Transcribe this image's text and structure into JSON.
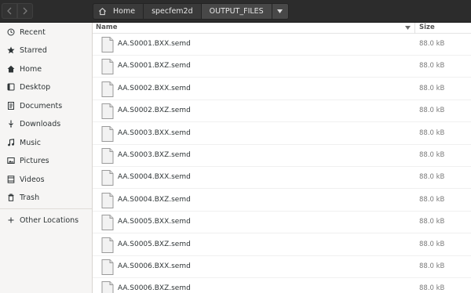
{
  "header": {
    "back_icon": "chevron-left-icon",
    "forward_icon": "chevron-right-icon",
    "breadcrumbs": [
      {
        "label": "Home",
        "icon": "home-icon"
      },
      {
        "label": "specfem2d"
      },
      {
        "label": "OUTPUT_FILES"
      }
    ],
    "dropdown_icon": "triangle-down-icon"
  },
  "sidebar": {
    "items": [
      {
        "label": "Recent",
        "icon": "clock-icon"
      },
      {
        "label": "Starred",
        "icon": "star-icon"
      },
      {
        "label": "Home",
        "icon": "home-icon"
      },
      {
        "label": "Desktop",
        "icon": "desktop-icon"
      },
      {
        "label": "Documents",
        "icon": "document-icon"
      },
      {
        "label": "Downloads",
        "icon": "download-icon"
      },
      {
        "label": "Music",
        "icon": "music-icon"
      },
      {
        "label": "Pictures",
        "icon": "picture-icon"
      },
      {
        "label": "Videos",
        "icon": "video-icon"
      },
      {
        "label": "Trash",
        "icon": "trash-icon"
      }
    ],
    "other_locations": {
      "label": "Other Locations",
      "icon": "plus-icon"
    }
  },
  "list": {
    "columns": {
      "name": "Name",
      "size": "Size"
    },
    "sort_icon": "sort-descending-icon",
    "files": [
      {
        "name": "AA.S0001.BXX.semd",
        "size": "88.0 kB"
      },
      {
        "name": "AA.S0001.BXZ.semd",
        "size": "88.0 kB"
      },
      {
        "name": "AA.S0002.BXX.semd",
        "size": "88.0 kB"
      },
      {
        "name": "AA.S0002.BXZ.semd",
        "size": "88.0 kB"
      },
      {
        "name": "AA.S0003.BXX.semd",
        "size": "88.0 kB"
      },
      {
        "name": "AA.S0003.BXZ.semd",
        "size": "88.0 kB"
      },
      {
        "name": "AA.S0004.BXX.semd",
        "size": "88.0 kB"
      },
      {
        "name": "AA.S0004.BXZ.semd",
        "size": "88.0 kB"
      },
      {
        "name": "AA.S0005.BXX.semd",
        "size": "88.0 kB"
      },
      {
        "name": "AA.S0005.BXZ.semd",
        "size": "88.0 kB"
      },
      {
        "name": "AA.S0006.BXX.semd",
        "size": "88.0 kB"
      },
      {
        "name": "AA.S0006.BXZ.semd",
        "size": "88.0 kB"
      }
    ]
  }
}
